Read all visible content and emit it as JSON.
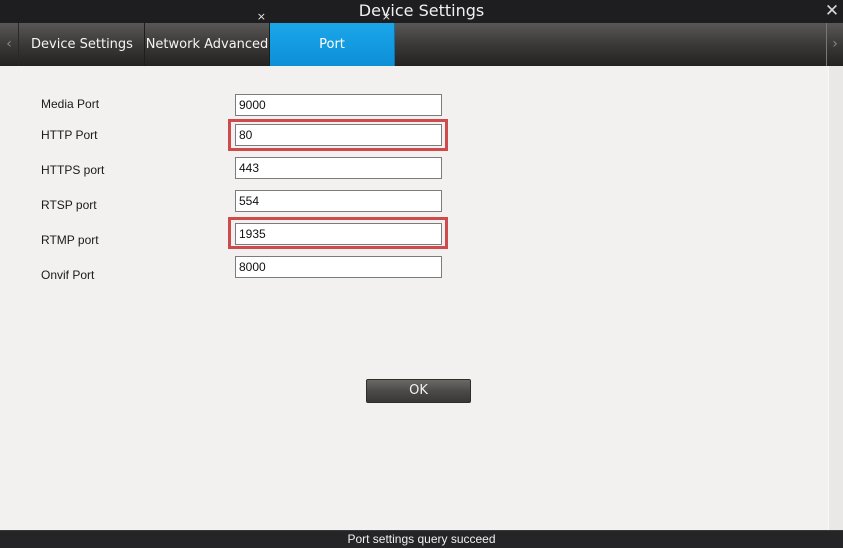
{
  "window": {
    "title": "Device Settings",
    "close_icon": "close-icon"
  },
  "tabs": {
    "prev_icon": "chevron-left-icon",
    "next_icon": "chevron-right-icon",
    "items": [
      {
        "label": "Device Settings",
        "active": false,
        "closable": false
      },
      {
        "label": "Network Advanced",
        "active": false,
        "closable": true
      },
      {
        "label": "Port",
        "active": true,
        "closable": true
      }
    ],
    "close_glyph": "×"
  },
  "nav_glyphs": {
    "prev": "‹",
    "next": "›",
    "close": "✕"
  },
  "form": {
    "fields": [
      {
        "label": "Media Port",
        "value": "9000",
        "highlighted": false
      },
      {
        "label": "HTTP Port",
        "value": "80",
        "highlighted": true
      },
      {
        "label": "HTTPS port",
        "value": "443",
        "highlighted": false
      },
      {
        "label": "RTSP port",
        "value": "554",
        "highlighted": false
      },
      {
        "label": "RTMP port",
        "value": "1935",
        "highlighted": true
      },
      {
        "label": "Onvif Port",
        "value": "8000",
        "highlighted": false
      }
    ],
    "ok_label": "OK"
  },
  "status": {
    "message": "Port settings query succeed"
  },
  "colors": {
    "active_tab": "#0c8fd6",
    "highlight": "#cf4a4a",
    "titlebar": "#1e1e20"
  }
}
